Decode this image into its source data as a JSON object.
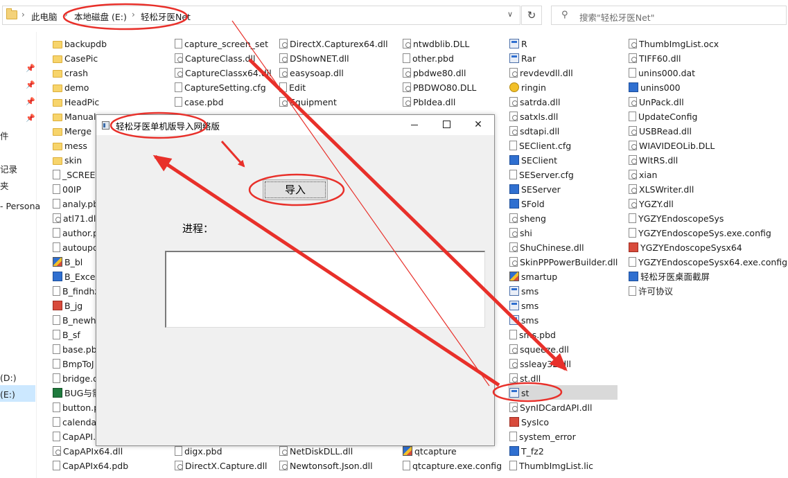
{
  "address_bar": {
    "crumbs": [
      "此电脑",
      "本地磁盘 (E:)",
      "轻松牙医Net"
    ],
    "search_placeholder": "搜索\"轻松牙医Net\""
  },
  "nav_pane": {
    "items": [
      "件",
      "记录",
      "夹",
      "- Persona",
      "(D:)",
      "(E:)"
    ]
  },
  "files": {
    "col1": [
      "backupdb",
      "CasePic",
      "crash",
      "demo",
      "HeadPic",
      "Manual",
      "Merge",
      "mess",
      "skin",
      "_SCREEN",
      "00IP",
      "analy.pb",
      "atl71.dll",
      "author.p",
      "autoupd",
      "B_bl",
      "B_Excel",
      "B_findhz",
      "B_jg",
      "B_newhz",
      "B_sf",
      "base.pb",
      "BmpToJ",
      "bridge.d",
      "BUG与需",
      "button.p",
      "calenda",
      "CapAPI.",
      "CapAPIx64.dll",
      "CapAPIx64.pdb"
    ],
    "col2": [
      "capture_screen_set",
      "CaptureClass.dll",
      "CaptureClassx64.dll",
      "CaptureSetting.cfg",
      "case.pbd",
      "digx.pbd",
      "DirectX.Capture.dll"
    ],
    "col3": [
      "DirectX.Capturex64.dll",
      "DShowNET.dll",
      "easysoap.dll",
      "Edit",
      "Equipment",
      "NetDiskDLL.dll",
      "Newtonsoft.Json.dll"
    ],
    "col4": [
      "ntwdblib.DLL",
      "other.pbd",
      "pbdwe80.dll",
      "PBDWO80.DLL",
      "PbIdea.dll",
      "qtcapture",
      "qtcapture.exe.config"
    ],
    "col5": [
      "R",
      "Rar",
      "revdevdll.dll",
      "ringin",
      "satrda.dll",
      "satxls.dll",
      "sdtapi.dll",
      "SEClient.cfg",
      "SEClient",
      "SEServer.cfg",
      "SEServer",
      "SFold",
      "sheng",
      "shi",
      "ShuChinese.dll",
      "SkinPPPowerBuilder.dll",
      "smartup",
      "sms",
      "sms",
      "sms",
      "sms.pbd",
      "squeeze.dll",
      "ssleay32.dll",
      "st.dll",
      "st",
      "SynIDCardAPI.dll",
      "SysIco",
      "system_error",
      "T_fz2",
      "ThumbImgList.lic"
    ],
    "col6": [
      "ThumbImgList.ocx",
      "TIFF60.dll",
      "unins000.dat",
      "unins000",
      "UnPack.dll",
      "UpdateConfig",
      "USBRead.dll",
      "WIAVIDEOLib.DLL",
      "WltRS.dll",
      "xian",
      "XLSWriter.dll",
      "YGZY.dll",
      "YGZYEndoscopeSys",
      "YGZYEndoscopeSys.exe.config",
      "YGZYEndoscopeSysx64",
      "YGZYEndoscopeSysx64.exe.config",
      "轻松牙医桌面截屏",
      "许可协议"
    ]
  },
  "dialog": {
    "title": "轻松牙医单机版导入网络版",
    "import_button": "导入",
    "progress_label": "进程："
  },
  "annotation_color": "#e8302a"
}
